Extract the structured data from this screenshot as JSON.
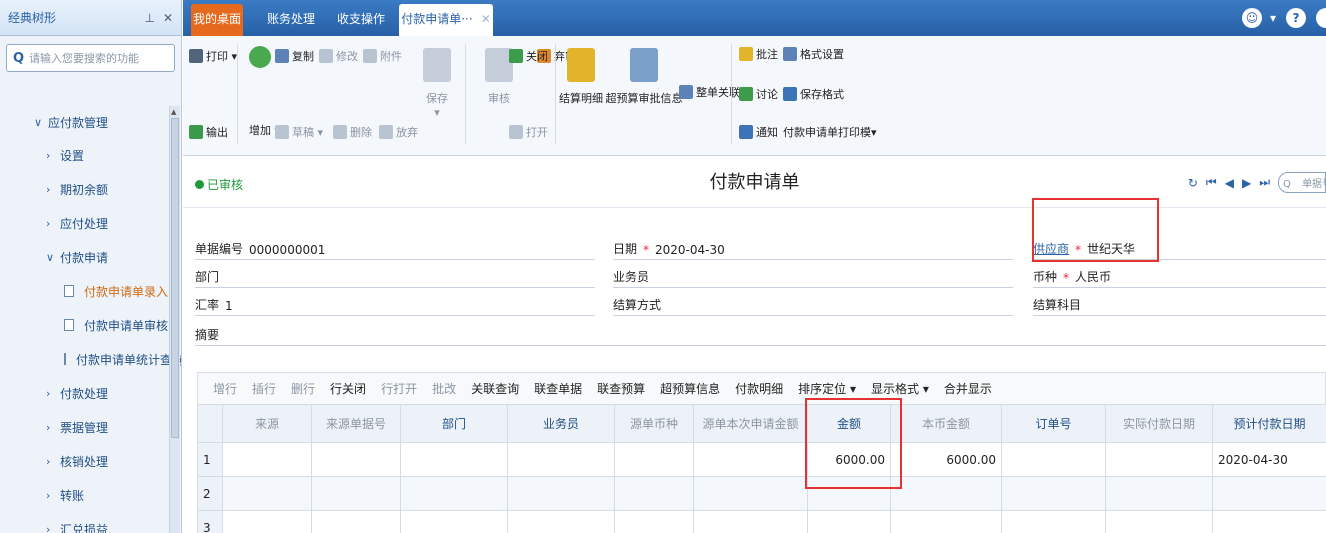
{
  "sidebar": {
    "title": "经典树形",
    "pin": "⊥",
    "close": "✕",
    "search_placeholder": "请输入您要搜索的功能",
    "tree": [
      {
        "label": "应付款管理",
        "level": 1,
        "expanded": true
      },
      {
        "label": "设置",
        "level": 2
      },
      {
        "label": "期初余额",
        "level": 2
      },
      {
        "label": "应付处理",
        "level": 2
      },
      {
        "label": "付款申请",
        "level": 2,
        "expanded": true
      },
      {
        "label": "付款申请单录入",
        "level": 3,
        "selected": true
      },
      {
        "label": "付款申请单审核",
        "level": 3
      },
      {
        "label": "付款申请单统计查询",
        "level": 3
      },
      {
        "label": "付款处理",
        "level": 2
      },
      {
        "label": "票据管理",
        "level": 2
      },
      {
        "label": "核销处理",
        "level": 2
      },
      {
        "label": "转账",
        "level": 2
      },
      {
        "label": "汇兑损益",
        "level": 2
      }
    ]
  },
  "tabs": {
    "home": "我的桌面",
    "t2": "账务处理",
    "t3": "收支操作",
    "active": "付款申请单···",
    "close": "✕"
  },
  "toolbar": {
    "print": "打印",
    "output": "输出",
    "copy": "复制",
    "add": "增加",
    "modify": "修改",
    "attach": "附件",
    "draft": "草稿",
    "delete": "删除",
    "abandon": "放弃",
    "save": "保存",
    "approve": "审核",
    "unapprove": "弃审",
    "close": "关闭",
    "open": "打开",
    "settle": "结算明细",
    "overbudget": "超预算审批信息",
    "assoc": "整单关联",
    "annotate": "批注",
    "discuss": "讨论",
    "notify": "通知",
    "format_settings": "格式设置",
    "save_format": "保存格式",
    "print_template": "付款申请单打印模▾"
  },
  "header": {
    "status": "已审核",
    "title": "付款申请单",
    "search_placeholder": "单据号"
  },
  "form": {
    "doc_no_label": "单据编号",
    "doc_no": "0000000001",
    "date_label": "日期",
    "date": "2020-04-30",
    "supplier_label": "供应商",
    "supplier": "世纪天华",
    "dept_label": "部门",
    "clerk_label": "业务员",
    "currency_label": "币种",
    "currency": "人民币",
    "rate_label": "汇率",
    "rate": "1",
    "settle_label": "结算方式",
    "settle_subject_label": "结算科目",
    "summary_label": "摘要",
    "req": "*"
  },
  "grid_tools": [
    "增行",
    "插行",
    "删行",
    "行关闭",
    "行打开",
    "批改",
    "关联查询",
    "联查单据",
    "联查预算",
    "超预算信息",
    "付款明细",
    "排序定位 ▾",
    "显示格式 ▾",
    "合并显示"
  ],
  "grid": {
    "headers": [
      "",
      "来源",
      "来源单据号",
      "部门",
      "业务员",
      "源单币种",
      "源单本次申请金额",
      "金额",
      "本币金额",
      "订单号",
      "实际付款日期",
      "预计付款日期"
    ],
    "rows": [
      [
        "1",
        "",
        "",
        "",
        "",
        "",
        "",
        "6000.00",
        "6000.00",
        "",
        "",
        "2020-04-30"
      ],
      [
        "2",
        "",
        "",
        "",
        "",
        "",
        "",
        "",
        "",
        "",
        "",
        ""
      ],
      [
        "3",
        "",
        "",
        "",
        "",
        "",
        "",
        "",
        "",
        "",
        "",
        ""
      ]
    ]
  }
}
